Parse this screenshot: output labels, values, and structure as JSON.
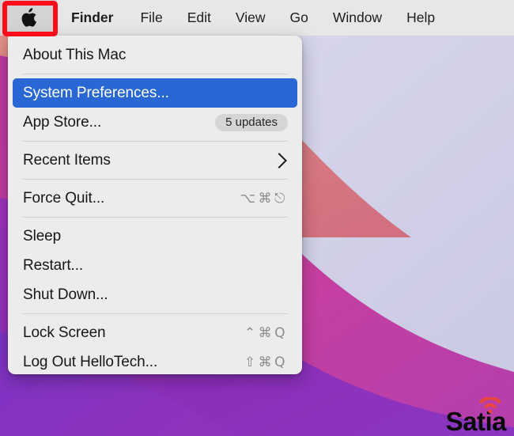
{
  "menubar": {
    "apple_icon": "apple-logo-icon",
    "items": [
      {
        "label": "Finder",
        "bold": true
      },
      {
        "label": "File",
        "bold": false
      },
      {
        "label": "Edit",
        "bold": false
      },
      {
        "label": "View",
        "bold": false
      },
      {
        "label": "Go",
        "bold": false
      },
      {
        "label": "Window",
        "bold": false
      },
      {
        "label": "Help",
        "bold": false
      }
    ],
    "background_color": "#e7e7e7",
    "apple_cell_color": "#d3d3d3"
  },
  "annotation": {
    "highlight_color": "#fc0d1b",
    "target": "apple-menu-cell"
  },
  "apple_menu": {
    "groups": [
      {
        "items": [
          {
            "label": "About This Mac",
            "shortcut": "",
            "badge": "",
            "selected": false,
            "submenu": false
          }
        ]
      },
      {
        "items": [
          {
            "label": "System Preferences...",
            "shortcut": "",
            "badge": "",
            "selected": true,
            "submenu": false
          },
          {
            "label": "App Store...",
            "shortcut": "",
            "badge": "5 updates",
            "selected": false,
            "submenu": false
          }
        ]
      },
      {
        "items": [
          {
            "label": "Recent Items",
            "shortcut": "",
            "badge": "",
            "selected": false,
            "submenu": true
          }
        ]
      },
      {
        "items": [
          {
            "label": "Force Quit...",
            "shortcut": "⌥⌘⎋",
            "badge": "",
            "selected": false,
            "submenu": false
          }
        ]
      },
      {
        "items": [
          {
            "label": "Sleep",
            "shortcut": "",
            "badge": "",
            "selected": false,
            "submenu": false
          },
          {
            "label": "Restart...",
            "shortcut": "",
            "badge": "",
            "selected": false,
            "submenu": false
          },
          {
            "label": "Shut Down...",
            "shortcut": "",
            "badge": "",
            "selected": false,
            "submenu": false
          }
        ]
      },
      {
        "items": [
          {
            "label": "Lock Screen",
            "shortcut": "⌃⌘Q",
            "badge": "",
            "selected": false,
            "submenu": false
          },
          {
            "label": "Log Out HelloTech...",
            "shortcut": "⇧⌘Q",
            "badge": "",
            "selected": false,
            "submenu": false
          }
        ]
      }
    ],
    "selection_color": "#2867d4",
    "panel_color": "#ececed"
  },
  "desktop": {
    "wallpaper_name": "monterey-waves",
    "colors": {
      "lavender": "#d2d1e8",
      "salmon": "#dc8082",
      "magenta": "#c33ba5",
      "pink": "#c93f9e",
      "purple": "#8b2fb8",
      "violet": "#7b32c4"
    }
  },
  "watermark": {
    "text": "Satia",
    "icon": "wifi-icon",
    "icon_color": "#e8463f"
  }
}
